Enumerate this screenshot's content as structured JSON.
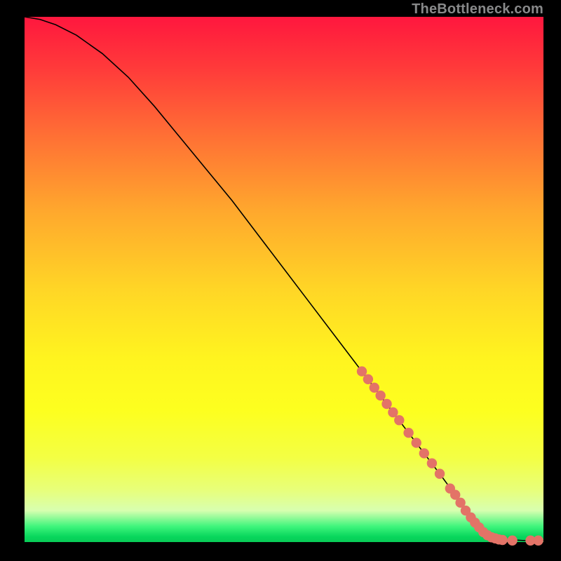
{
  "watermark": "TheBottleneck.com",
  "chart_data": {
    "type": "line",
    "title": "",
    "xlabel": "",
    "ylabel": "",
    "xlim": [
      0,
      100
    ],
    "ylim": [
      0,
      100
    ],
    "series": [
      {
        "name": "curve",
        "x": [
          0,
          3,
          6,
          10,
          15,
          20,
          25,
          30,
          35,
          40,
          45,
          50,
          55,
          60,
          65,
          70,
          75,
          80,
          83,
          85,
          87,
          90,
          93,
          96,
          100
        ],
        "y": [
          100,
          99.5,
          98.5,
          96.5,
          93,
          88.5,
          83,
          77,
          71,
          65,
          58.5,
          52,
          45.5,
          39,
          32.5,
          26,
          19.5,
          13,
          9,
          6,
          3.5,
          1.2,
          0.5,
          0.3,
          0.3
        ]
      }
    ],
    "markers": [
      {
        "x": 65.0,
        "y": 32.5
      },
      {
        "x": 66.2,
        "y": 31.0
      },
      {
        "x": 67.4,
        "y": 29.4
      },
      {
        "x": 68.6,
        "y": 27.9
      },
      {
        "x": 69.8,
        "y": 26.3
      },
      {
        "x": 71.0,
        "y": 24.7
      },
      {
        "x": 72.2,
        "y": 23.2
      },
      {
        "x": 74.0,
        "y": 20.8
      },
      {
        "x": 75.5,
        "y": 18.9
      },
      {
        "x": 77.0,
        "y": 16.9
      },
      {
        "x": 78.5,
        "y": 15.0
      },
      {
        "x": 80.0,
        "y": 13.0
      },
      {
        "x": 82.0,
        "y": 10.2
      },
      {
        "x": 83.0,
        "y": 9.0
      },
      {
        "x": 84.0,
        "y": 7.5
      },
      {
        "x": 85.0,
        "y": 6.0
      },
      {
        "x": 86.0,
        "y": 4.7
      },
      {
        "x": 86.8,
        "y": 3.7
      },
      {
        "x": 87.6,
        "y": 2.8
      },
      {
        "x": 88.4,
        "y": 1.9
      },
      {
        "x": 89.2,
        "y": 1.3
      },
      {
        "x": 90.0,
        "y": 0.9
      },
      {
        "x": 90.7,
        "y": 0.7
      },
      {
        "x": 91.4,
        "y": 0.5
      },
      {
        "x": 92.1,
        "y": 0.4
      },
      {
        "x": 94.0,
        "y": 0.3
      },
      {
        "x": 97.5,
        "y": 0.3
      },
      {
        "x": 99.0,
        "y": 0.3
      }
    ],
    "marker_color": "#e37367",
    "curve_color": "#000000"
  }
}
